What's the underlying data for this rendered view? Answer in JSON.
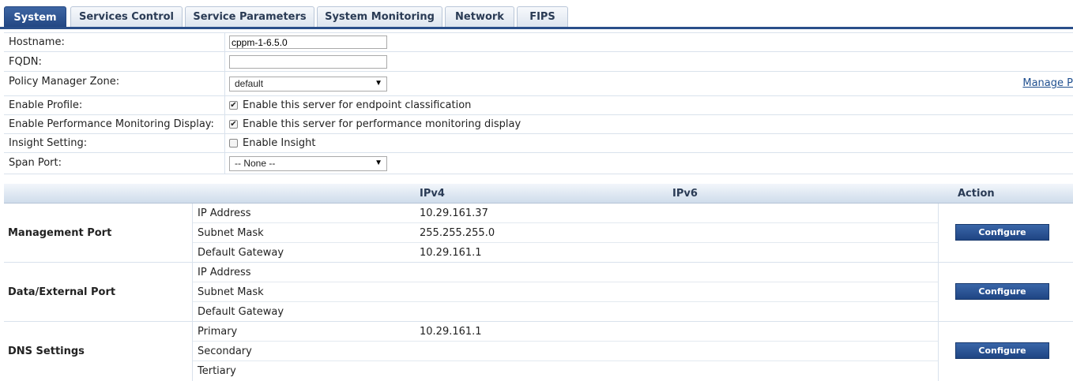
{
  "tabs": [
    "System",
    "Services Control",
    "Service Parameters",
    "System Monitoring",
    "Network",
    "FIPS"
  ],
  "form": {
    "hostname_label": "Hostname:",
    "hostname_value": "cppm-1-6.5.0",
    "fqdn_label": "FQDN:",
    "fqdn_value": "",
    "zone_label": "Policy Manager Zone:",
    "zone_value": "default",
    "manage_link": "Manage P",
    "profile_label": "Enable Profile:",
    "profile_text": "Enable this server for endpoint classification",
    "profile_checked": true,
    "perf_label": "Enable Performance Monitoring Display:",
    "perf_text": "Enable this server for performance monitoring display",
    "perf_checked": true,
    "insight_label": "Insight Setting:",
    "insight_text": "Enable Insight",
    "insight_checked": false,
    "span_label": "Span Port:",
    "span_value": "-- None --"
  },
  "table": {
    "headers": {
      "ipv4": "IPv4",
      "ipv6": "IPv6",
      "action": "Action"
    },
    "configure_label": "Configure",
    "groups": [
      {
        "name": "Management Port",
        "rows": [
          {
            "label": "IP Address",
            "ipv4": "10.29.161.37",
            "ipv6": ""
          },
          {
            "label": "Subnet Mask",
            "ipv4": "255.255.255.0",
            "ipv6": ""
          },
          {
            "label": "Default Gateway",
            "ipv4": "10.29.161.1",
            "ipv6": ""
          }
        ]
      },
      {
        "name": "Data/External Port",
        "rows": [
          {
            "label": "IP Address",
            "ipv4": "",
            "ipv6": ""
          },
          {
            "label": "Subnet Mask",
            "ipv4": "",
            "ipv6": ""
          },
          {
            "label": "Default Gateway",
            "ipv4": "",
            "ipv6": ""
          }
        ]
      },
      {
        "name": "DNS Settings",
        "rows": [
          {
            "label": "Primary",
            "ipv4": "10.29.161.1",
            "ipv6": ""
          },
          {
            "label": "Secondary",
            "ipv4": "",
            "ipv6": ""
          },
          {
            "label": "Tertiary",
            "ipv4": "",
            "ipv6": ""
          }
        ]
      }
    ]
  },
  "icons": {
    "checkbox_checked": "check-icon",
    "select_arrow": "chevron-down-icon"
  }
}
